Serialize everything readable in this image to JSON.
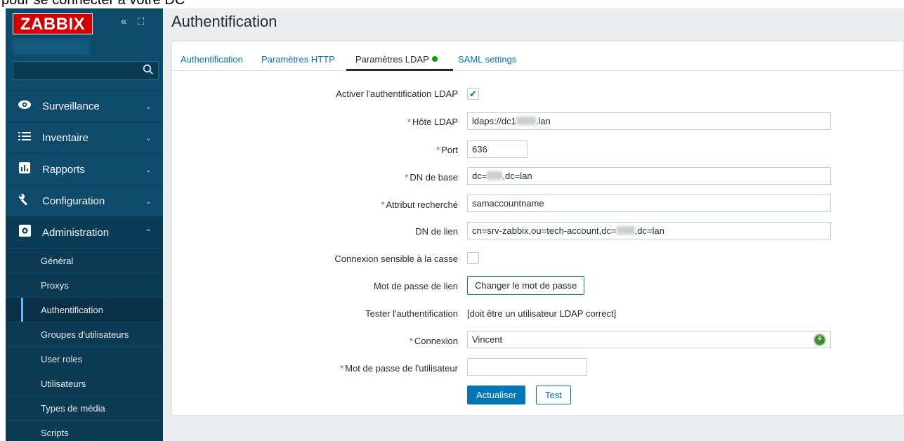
{
  "top_banner": "pour se connecter à votre DC",
  "sidebar": {
    "logo": "ZABBIX",
    "collapse_icon": "«",
    "kiosk_icon": "⛶",
    "search_placeholder": "",
    "menu": [
      {
        "label": "Surveillance",
        "icon": "eye-icon"
      },
      {
        "label": "Inventaire",
        "icon": "list-icon"
      },
      {
        "label": "Rapports",
        "icon": "chart-icon"
      },
      {
        "label": "Configuration",
        "icon": "wrench-icon"
      },
      {
        "label": "Administration",
        "icon": "gear-icon"
      }
    ],
    "admin_items": [
      "Général",
      "Proxys",
      "Authentification",
      "Groupes d'utilisateurs",
      "User roles",
      "Utilisateurs",
      "Types de média",
      "Scripts"
    ]
  },
  "page_title": "Authentification",
  "tabs": [
    "Authentification",
    "Paramètres HTTP",
    "Paramètres LDAP",
    "SAML settings"
  ],
  "form": {
    "enable_label": "Activer l'authentification LDAP",
    "enable_checked": true,
    "host_label": "Hôte LDAP",
    "host_prefix": "ldaps://dc1",
    "host_suffix": ".lan",
    "port_label": "Port",
    "port_value": "636",
    "base_dn_label": "DN de base",
    "base_dn_prefix": "dc=",
    "base_dn_suffix": ",dc=lan",
    "search_attr_label": "Attribut recherché",
    "search_attr_value": "samaccountname",
    "bind_dn_label": "DN de lien",
    "bind_dn_prefix": "cn=srv-zabbix,ou=tech-account,dc=",
    "bind_dn_suffix": ",dc=lan",
    "case_label": "Connexion sensible à la casse",
    "case_checked": false,
    "bind_pw_label": "Mot de passe de lien",
    "bind_pw_button": "Changer le mot de passe",
    "test_auth_label": "Tester l'authentification",
    "test_auth_hint": "[doit être un utilisateur LDAP correct]",
    "login_label": "Connexion",
    "login_value": "Vincent",
    "user_pw_label": "Mot de passe de l'utilisateur",
    "user_pw_value": "",
    "required_mark": "*",
    "update_button": "Actualiser",
    "test_button": "Test"
  }
}
